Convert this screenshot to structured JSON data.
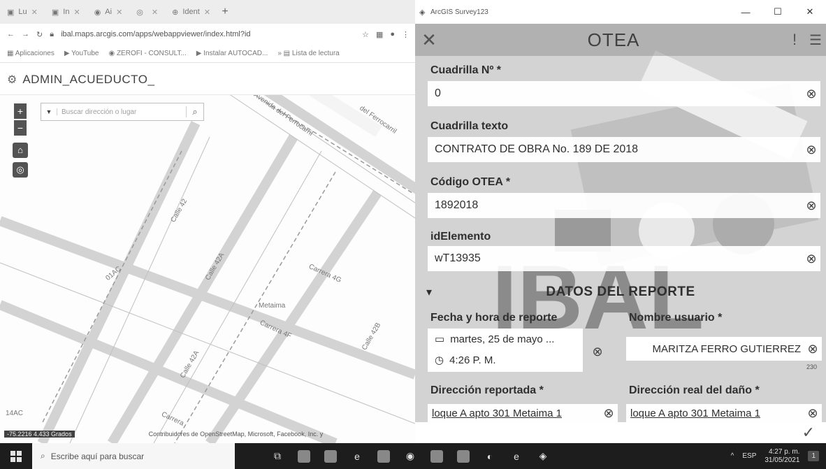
{
  "browser": {
    "tabs": [
      {
        "label": "Lu"
      },
      {
        "label": "In"
      },
      {
        "label": "Ai"
      },
      {
        "label": ""
      },
      {
        "label": "Ident"
      }
    ],
    "url": "ibal.maps.arcgis.com/apps/webappviewer/index.html?id",
    "bookmarks": [
      "Aplicaciones",
      "YouTube",
      "ZEROFI - CONSULT...",
      "Instalar AUTOCAD...",
      "Lista de lectura"
    ],
    "app_title": "ADMIN_ACUEDUCTO_",
    "search_placeholder": "Buscar dirección o lugar",
    "map_labels": {
      "l1": "Avenida del Ferrocarril",
      "l2": "del Ferrocarril",
      "l3": "Calle 42",
      "l4": "Calle 42A",
      "l5": "Carrera 4G",
      "l6": "Metaima",
      "l7": "Carrera 4F",
      "l8": "Calle 42A",
      "l9": "Calle 42B",
      "l10": "Carrera",
      "l11": "01AC",
      "l12": "14AC"
    },
    "scale_text": "-75.2216 4.433 Grados",
    "attribution": "Contribuidores de OpenStreetMap, Microsoft, Facebook, Inc. y sus afiliados, Esri Community Maps, Esri, HERE, Garmin, USGS, EPA, NPS"
  },
  "survey": {
    "window_title": "ArcGIS Survey123",
    "form_title": "OTEA",
    "fields": {
      "cuadrilla_label": "Cuadrilla Nº *",
      "cuadrilla_value": "0",
      "cuadrilla_texto_label": "Cuadrilla texto",
      "cuadrilla_texto_value": "CONTRATO DE OBRA No. 189 DE 2018",
      "codigo_label": "Código OTEA *",
      "codigo_value": "1892018",
      "idelemento_label": "idElemento",
      "idelemento_value": "wT13935"
    },
    "section_title": "DATOS DEL REPORTE",
    "fecha_label": "Fecha y hora de reporte",
    "fecha_date": "martes, 25 de mayo ...",
    "fecha_time": "4:26 P. M.",
    "usuario_label": "Nombre usuario *",
    "usuario_value": "MARITZA FERRO GUTIERREZ",
    "usuario_counter": "230",
    "direccion_label": "Dirección reportada *",
    "direccion_value": "loque A apto 301 Metaima 1",
    "direccion_real_label": "Dirección real del daño *",
    "direccion_real_value": "loque A apto 301 Metaima 1"
  },
  "taskbar": {
    "search_placeholder": "Escribe aquí para buscar",
    "lang": "ESP",
    "time": "4:27 p. m.",
    "date": "31/05/2021",
    "notifications": "1"
  }
}
